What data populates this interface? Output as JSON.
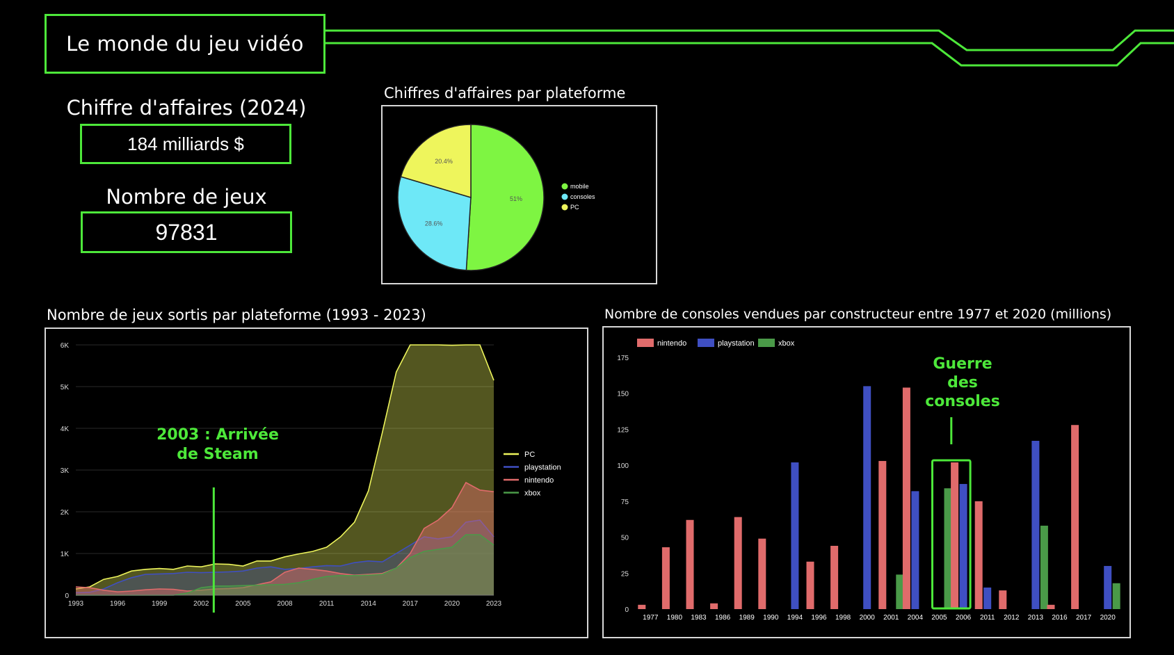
{
  "header": {
    "title": "Le monde du jeu vidéo"
  },
  "kpis": {
    "revenue": {
      "label": "Chiffre d'affaires (2024)",
      "value": "184 milliards $"
    },
    "games": {
      "label": "Nombre de jeux",
      "value": "97831"
    }
  },
  "colors": {
    "accent": "#4de83a",
    "mobile": "#7ef542",
    "consoles": "#6ee8f7",
    "pc": "#eef55c",
    "nintendo": "#e06b6b",
    "playstation": "#3f4fc2",
    "xbox": "#4a9a48"
  },
  "pie": {
    "title": "Chiffres d'affaires par plateforme"
  },
  "area": {
    "title": "Nombre de jeux sortis par plateforme (1993 - 2023)",
    "annotation_line1": "2003 : Arrivée",
    "annotation_line2": "de Steam"
  },
  "bars": {
    "title": "Nombre de consoles vendues par constructeur entre 1977 et 2020 (millions)",
    "annotation_line1": "Guerre",
    "annotation_line2": "des",
    "annotation_line3": "consoles"
  },
  "chart_data": [
    {
      "type": "pie",
      "title": "Chiffres d'affaires par plateforme",
      "labels": [
        "mobile",
        "consoles",
        "PC"
      ],
      "values": [
        51,
        28.6,
        20.4
      ],
      "value_labels": [
        "51%",
        "28.6%",
        "20.4%"
      ],
      "legend": "right"
    },
    {
      "type": "area",
      "title": "Nombre de jeux sortis par plateforme (1993 - 2023)",
      "x": [
        1993,
        1994,
        1995,
        1996,
        1997,
        1998,
        1999,
        2000,
        2001,
        2002,
        2003,
        2004,
        2005,
        2006,
        2007,
        2008,
        2009,
        2010,
        2011,
        2012,
        2013,
        2014,
        2015,
        2016,
        2017,
        2018,
        2019,
        2020,
        2021,
        2022,
        2023
      ],
      "x_ticks": [
        "1993",
        "1996",
        "1999",
        "2002",
        "2005",
        "2008",
        "2011",
        "2014",
        "2017",
        "2020",
        "2023"
      ],
      "y_ticks": [
        "0",
        "1K",
        "2K",
        "3K",
        "4K",
        "5K",
        "6K"
      ],
      "ylim": [
        0,
        6000
      ],
      "grid": true,
      "legend": "right",
      "series": [
        {
          "name": "PC",
          "values": [
            150,
            200,
            380,
            450,
            580,
            620,
            640,
            620,
            700,
            680,
            750,
            740,
            700,
            820,
            820,
            920,
            990,
            1050,
            1150,
            1400,
            1750,
            2500,
            3900,
            5350,
            6000,
            6000,
            6000,
            5990,
            6000,
            6000,
            5150
          ]
        },
        {
          "name": "playstation",
          "values": [
            60,
            70,
            150,
            300,
            420,
            500,
            510,
            520,
            550,
            540,
            550,
            560,
            580,
            650,
            680,
            620,
            640,
            680,
            710,
            700,
            780,
            820,
            800,
            1000,
            1200,
            1400,
            1350,
            1400,
            1750,
            1800,
            1400
          ]
        },
        {
          "name": "nintendo",
          "values": [
            200,
            180,
            120,
            80,
            100,
            130,
            150,
            140,
            100,
            120,
            150,
            160,
            180,
            250,
            320,
            550,
            650,
            620,
            580,
            520,
            480,
            500,
            520,
            650,
            1000,
            1600,
            1800,
            2100,
            2700,
            2520,
            2480
          ]
        },
        {
          "name": "xbox",
          "values": [
            0,
            0,
            0,
            0,
            0,
            0,
            0,
            0,
            50,
            180,
            220,
            220,
            230,
            240,
            250,
            260,
            300,
            380,
            450,
            470,
            470,
            480,
            500,
            650,
            900,
            1050,
            1100,
            1150,
            1450,
            1450,
            1200
          ]
        }
      ]
    },
    {
      "type": "bar",
      "title": "Nombre de consoles vendues par constructeur entre 1977 et 2020 (millions)",
      "categories": [
        "1977",
        "1980",
        "1983",
        "1986",
        "1989",
        "1990",
        "1994",
        "1996",
        "1998",
        "2000",
        "2001",
        "2004",
        "2005",
        "2006",
        "2011",
        "2012",
        "2013",
        "2016",
        "2017",
        "2020"
      ],
      "ylim": [
        0,
        175
      ],
      "y_ticks": [
        "0",
        "25",
        "50",
        "75",
        "100",
        "125",
        "150",
        "175"
      ],
      "legend": "top-left",
      "series": [
        {
          "name": "nintendo",
          "values": [
            3,
            43,
            62,
            4,
            64,
            49,
            0,
            33,
            44,
            0,
            103,
            154,
            0,
            102,
            75,
            13,
            0,
            3,
            128,
            0
          ]
        },
        {
          "name": "playstation",
          "values": [
            0,
            0,
            0,
            0,
            0,
            0,
            102,
            0,
            0,
            155,
            0,
            82,
            0,
            87,
            15,
            0,
            117,
            0,
            0,
            30
          ]
        },
        {
          "name": "xbox",
          "values": [
            0,
            0,
            0,
            0,
            0,
            0,
            0,
            0,
            0,
            0,
            24,
            0,
            84,
            0,
            0,
            0,
            58,
            0,
            0,
            18
          ]
        }
      ]
    }
  ]
}
